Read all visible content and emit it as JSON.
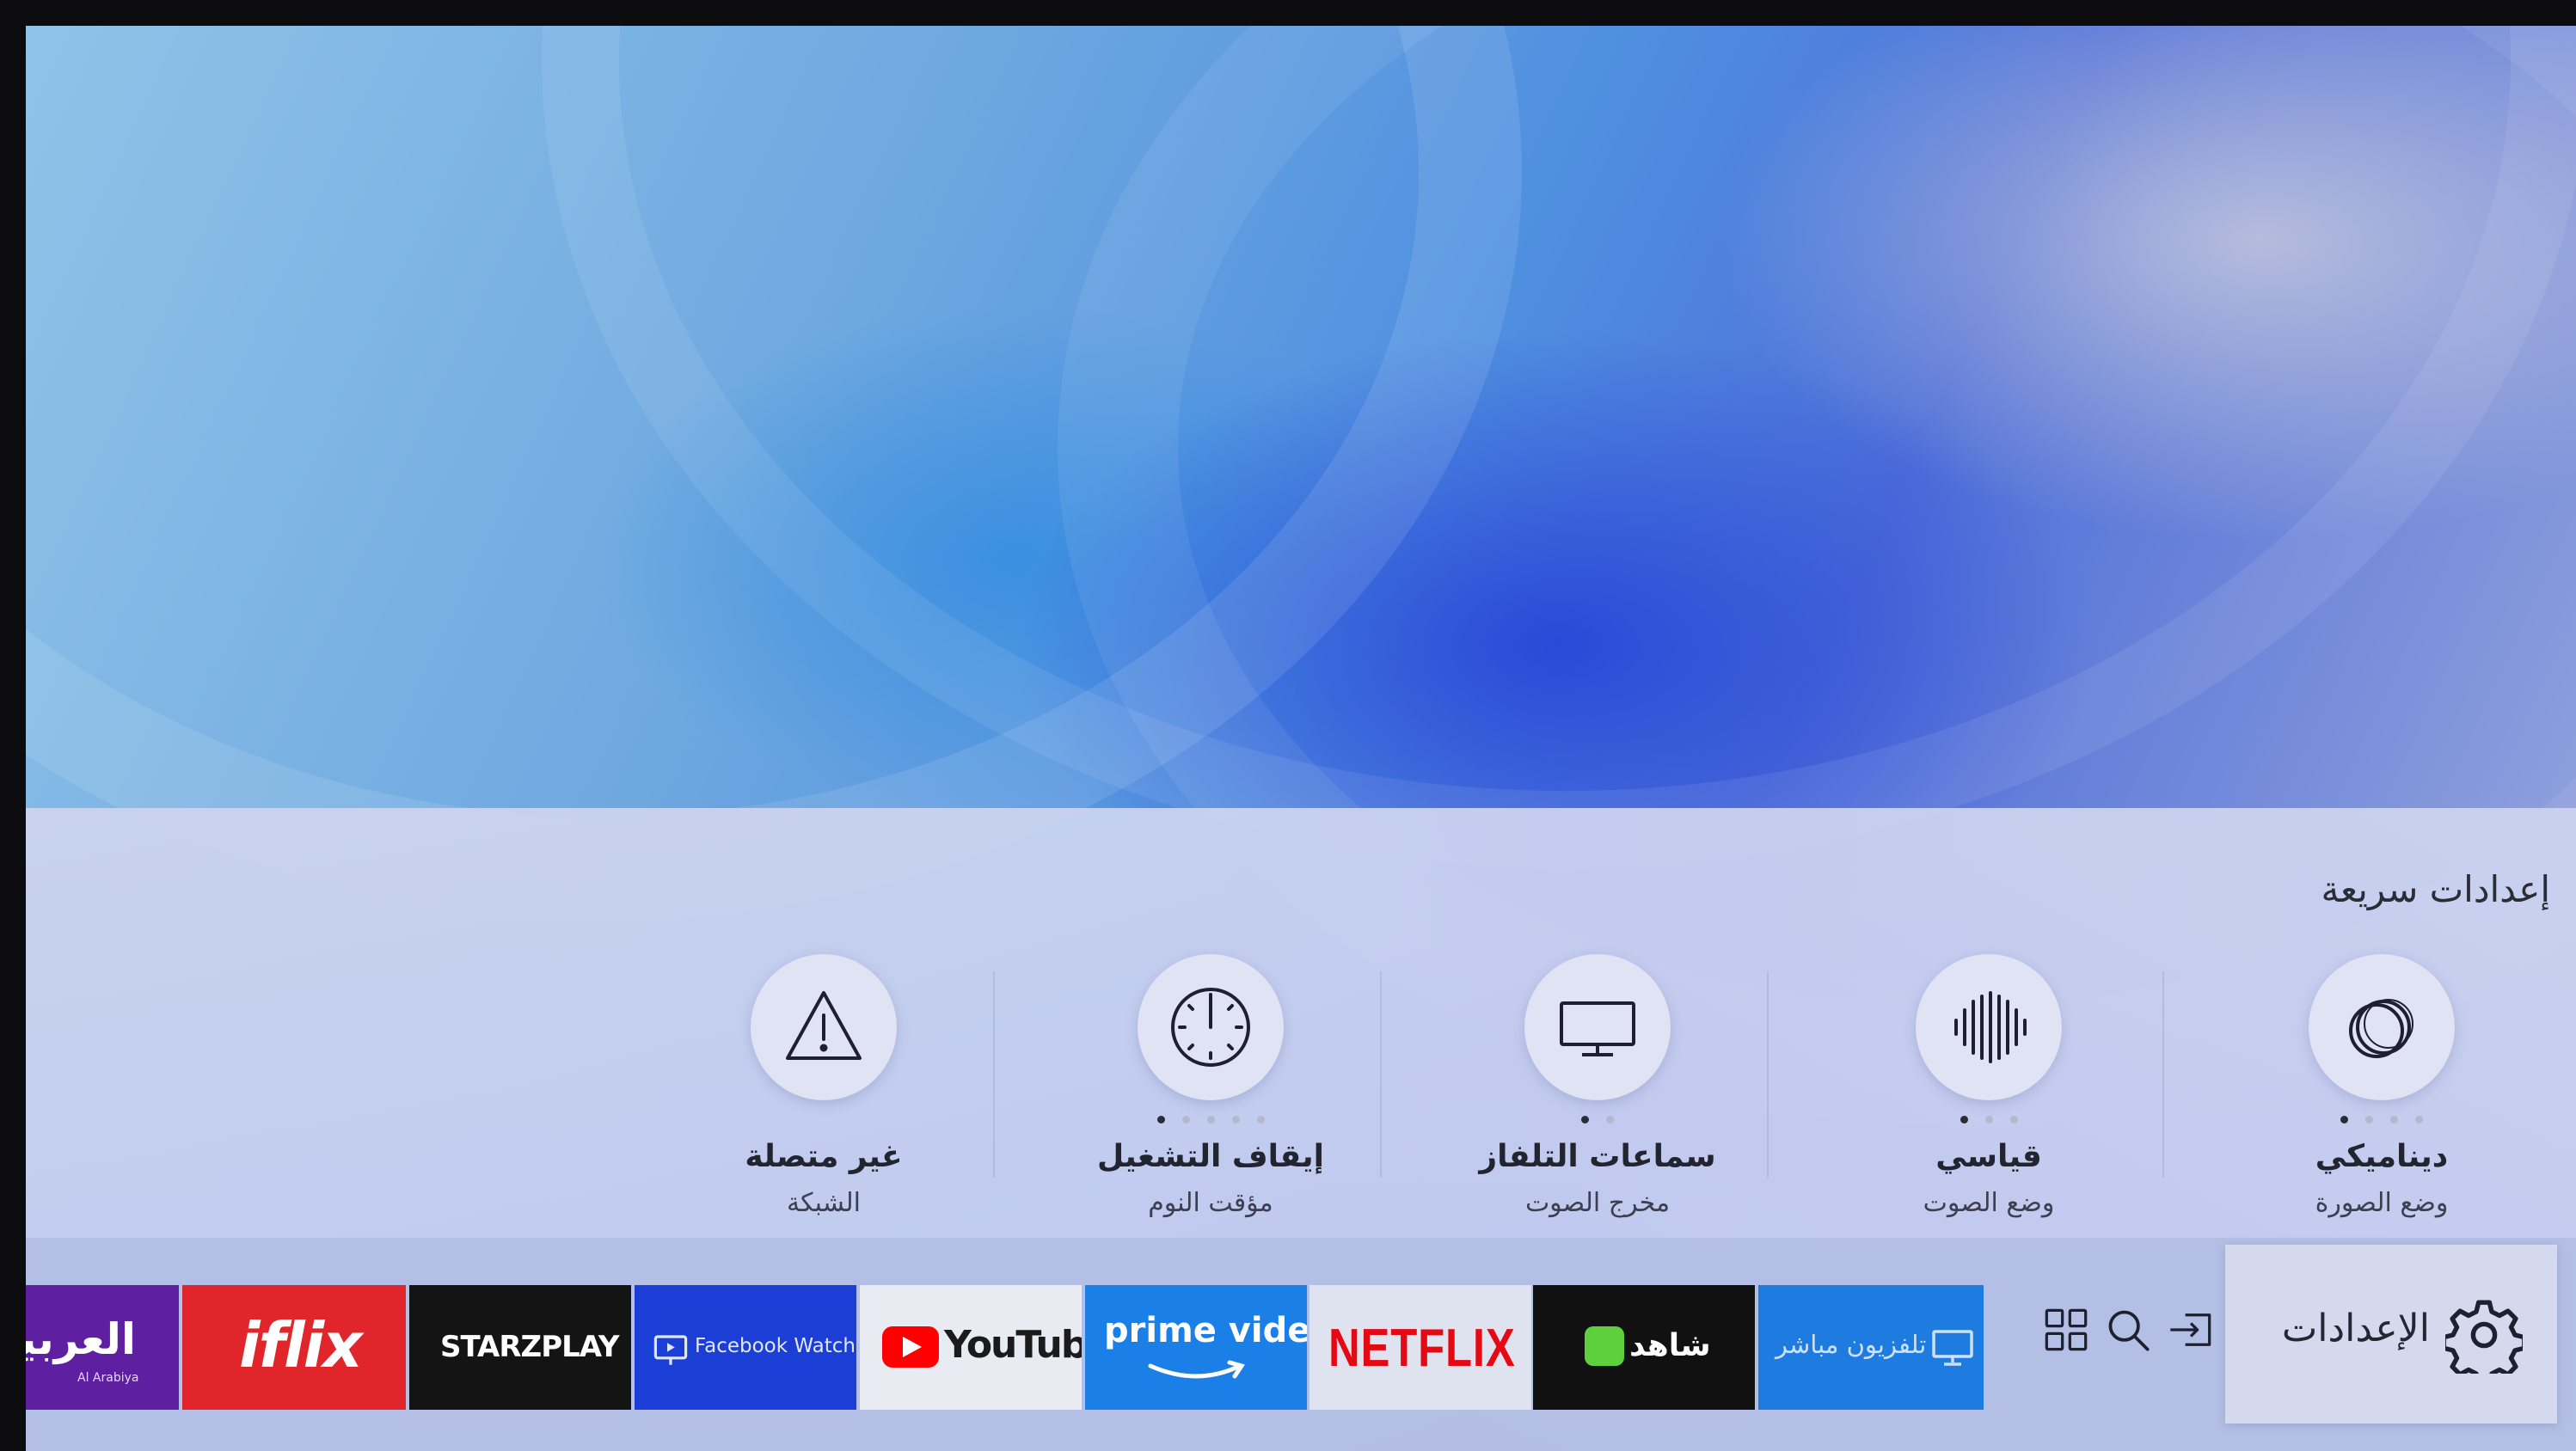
{
  "quick_settings": {
    "title": "إعدادات سريعة",
    "tiles": [
      {
        "value": "ديناميكي",
        "label": "وضع الصورة",
        "icon": "picture-mode-icon",
        "options": 4,
        "selected": 0
      },
      {
        "value": "قياسي",
        "label": "وضع الصوت",
        "icon": "sound-wave-icon",
        "options": 3,
        "selected": 0
      },
      {
        "value": "سماعات التلفاز",
        "label": "مخرج الصوت",
        "icon": "tv-monitor-icon",
        "options": 2,
        "selected": 0
      },
      {
        "value": "إيقاف التشغيل",
        "label": "مؤقت النوم",
        "icon": "clock-icon",
        "options": 5,
        "selected": 0
      },
      {
        "value": "غير متصلة",
        "label": "الشبكة",
        "icon": "warning-icon",
        "options": 0,
        "selected": -1
      }
    ]
  },
  "bottom_bar": {
    "settings_label": "الإعدادات",
    "apps": [
      {
        "name": "تلفزيون مباشر",
        "color": "#1e7be0"
      },
      {
        "name": "شاهد",
        "color": "#111111"
      },
      {
        "name": "NETFLIX",
        "color": "#dfe3ef"
      },
      {
        "name": "prime video",
        "color": "#1a7fe6"
      },
      {
        "name": "YouTube",
        "color": "#e9ebf3"
      },
      {
        "name": "Facebook Watch",
        "color": "#1b3fd6"
      },
      {
        "name": "STARZPLAY",
        "color": "#141414"
      },
      {
        "name": "iflix",
        "color": "#e1262b"
      },
      {
        "name": "العربية",
        "sub": "Al Arabiya",
        "color": "#5e1fa0"
      }
    ]
  },
  "colors": {
    "accent_netflix": "#e50914",
    "accent_youtube": "#ff0000",
    "shahid_green": "#5fd03d"
  }
}
